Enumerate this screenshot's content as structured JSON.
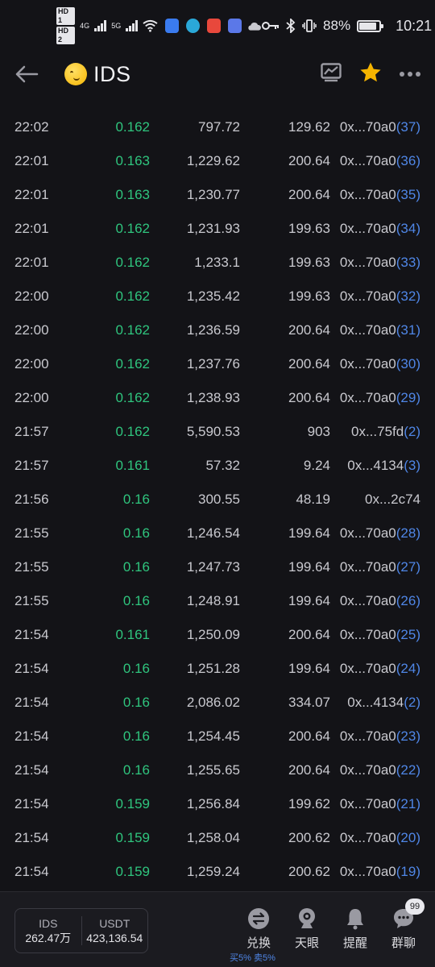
{
  "status_bar": {
    "hd1": "HD 1",
    "hd2": "HD 2",
    "net": "4G",
    "net2": "5G",
    "battery_percent": "88%",
    "battery_level": 0.88,
    "time": "10:21"
  },
  "header": {
    "title": "IDS",
    "back_icon": "arrow-left-icon",
    "chart_icon": "chart-icon",
    "favorite_icon": "star-icon",
    "more_icon": "more-dots-icon",
    "favorite_color": "#f5b400"
  },
  "colors": {
    "price_green": "#2fc57e",
    "link_blue": "#4f86e6",
    "background": "#131317"
  },
  "trades": [
    {
      "time": "22:02",
      "price": "0.162",
      "amount": "797.72",
      "value": "129.62",
      "address": "0x...70a0",
      "count": "(37)"
    },
    {
      "time": "22:01",
      "price": "0.163",
      "amount": "1,229.62",
      "value": "200.64",
      "address": "0x...70a0",
      "count": "(36)"
    },
    {
      "time": "22:01",
      "price": "0.163",
      "amount": "1,230.77",
      "value": "200.64",
      "address": "0x...70a0",
      "count": "(35)"
    },
    {
      "time": "22:01",
      "price": "0.162",
      "amount": "1,231.93",
      "value": "199.63",
      "address": "0x...70a0",
      "count": "(34)"
    },
    {
      "time": "22:01",
      "price": "0.162",
      "amount": "1,233.1",
      "value": "199.63",
      "address": "0x...70a0",
      "count": "(33)"
    },
    {
      "time": "22:00",
      "price": "0.162",
      "amount": "1,235.42",
      "value": "199.63",
      "address": "0x...70a0",
      "count": "(32)"
    },
    {
      "time": "22:00",
      "price": "0.162",
      "amount": "1,236.59",
      "value": "200.64",
      "address": "0x...70a0",
      "count": "(31)"
    },
    {
      "time": "22:00",
      "price": "0.162",
      "amount": "1,237.76",
      "value": "200.64",
      "address": "0x...70a0",
      "count": "(30)"
    },
    {
      "time": "22:00",
      "price": "0.162",
      "amount": "1,238.93",
      "value": "200.64",
      "address": "0x...70a0",
      "count": "(29)"
    },
    {
      "time": "21:57",
      "price": "0.162",
      "amount": "5,590.53",
      "value": "903",
      "address": "0x...75fd",
      "count": "(2)"
    },
    {
      "time": "21:57",
      "price": "0.161",
      "amount": "57.32",
      "value": "9.24",
      "address": "0x...4134",
      "count": "(3)"
    },
    {
      "time": "21:56",
      "price": "0.16",
      "amount": "300.55",
      "value": "48.19",
      "address": "0x...2c74",
      "count": ""
    },
    {
      "time": "21:55",
      "price": "0.16",
      "amount": "1,246.54",
      "value": "199.64",
      "address": "0x...70a0",
      "count": "(28)"
    },
    {
      "time": "21:55",
      "price": "0.16",
      "amount": "1,247.73",
      "value": "199.64",
      "address": "0x...70a0",
      "count": "(27)"
    },
    {
      "time": "21:55",
      "price": "0.16",
      "amount": "1,248.91",
      "value": "199.64",
      "address": "0x...70a0",
      "count": "(26)"
    },
    {
      "time": "21:54",
      "price": "0.161",
      "amount": "1,250.09",
      "value": "200.64",
      "address": "0x...70a0",
      "count": "(25)"
    },
    {
      "time": "21:54",
      "price": "0.16",
      "amount": "1,251.28",
      "value": "199.64",
      "address": "0x...70a0",
      "count": "(24)"
    },
    {
      "time": "21:54",
      "price": "0.16",
      "amount": "2,086.02",
      "value": "334.07",
      "address": "0x...4134",
      "count": "(2)"
    },
    {
      "time": "21:54",
      "price": "0.16",
      "amount": "1,254.45",
      "value": "200.64",
      "address": "0x...70a0",
      "count": "(23)"
    },
    {
      "time": "21:54",
      "price": "0.16",
      "amount": "1,255.65",
      "value": "200.64",
      "address": "0x...70a0",
      "count": "(22)"
    },
    {
      "time": "21:54",
      "price": "0.159",
      "amount": "1,256.84",
      "value": "199.62",
      "address": "0x...70a0",
      "count": "(21)"
    },
    {
      "time": "21:54",
      "price": "0.159",
      "amount": "1,258.04",
      "value": "200.62",
      "address": "0x...70a0",
      "count": "(20)"
    },
    {
      "time": "21:54",
      "price": "0.159",
      "amount": "1,259.24",
      "value": "200.62",
      "address": "0x...70a0",
      "count": "(19)"
    }
  ],
  "bottom_bar": {
    "balance": {
      "token_label": "IDS",
      "token_value": "262.47万",
      "quote_label": "USDT",
      "quote_value": "423,136.54"
    },
    "actions": {
      "swap": "兑换",
      "swap_sub": "买5% 卖5%",
      "watch": "天眼",
      "alert": "提醒",
      "chat": "群聊",
      "chat_badge": "99"
    }
  }
}
